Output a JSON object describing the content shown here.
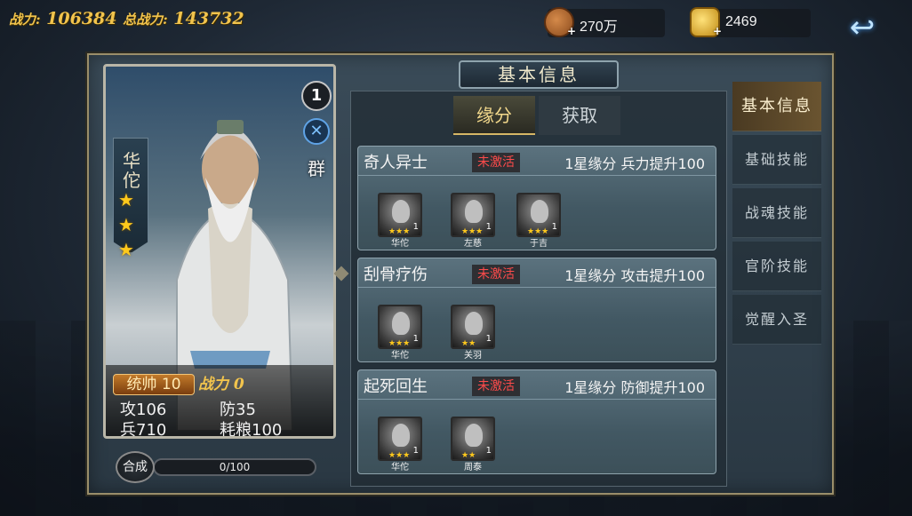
{
  "top_bar": {
    "power_label": "战力:",
    "power_value": "106384",
    "total_power_label": "总战力:",
    "total_power_value": "143732",
    "copper": {
      "icon": "copper-coin-icon",
      "value": "270万"
    },
    "gold": {
      "icon": "gold-ingot-icon",
      "value": "2469"
    },
    "back_icon": "back-arrow-icon",
    "back_glyph": "↩",
    "plus_glyph": "+"
  },
  "hero": {
    "name": "华佗",
    "stars": 3,
    "star_glyph": "★",
    "level": "1",
    "class_icon": "archer-class-icon",
    "class_glyph": "✕",
    "faction": "群",
    "command_label": "统帅",
    "command_value": "10",
    "command_power_label": "战力",
    "command_power_value": "0",
    "stats": {
      "attack_label": "攻",
      "attack_value": "106",
      "defense_label": "防",
      "defense_value": "35",
      "troops_label": "兵",
      "troops_value": "710",
      "food_label": "耗粮",
      "food_value": "100"
    }
  },
  "merge": {
    "button_label": "合成",
    "progress_text": "0/100",
    "progress": 0
  },
  "panel_title": "基本信息",
  "sub_tabs": [
    {
      "label": "缘分",
      "active": true
    },
    {
      "label": "获取",
      "active": false
    }
  ],
  "fates": [
    {
      "title": "奇人异士",
      "status": "未激活",
      "effect": "1星缘分 兵力提升100",
      "members": [
        {
          "name": "华佗",
          "stars": "★★★",
          "count": "1"
        },
        {
          "name": "左慈",
          "stars": "★★★",
          "count": "1"
        },
        {
          "name": "于吉",
          "stars": "★★★",
          "count": "1"
        }
      ]
    },
    {
      "title": "刮骨疗伤",
      "status": "未激活",
      "effect": "1星缘分 攻击提升100",
      "members": [
        {
          "name": "华佗",
          "stars": "★★★",
          "count": "1"
        },
        {
          "name": "关羽",
          "stars": "★★",
          "count": "1"
        }
      ]
    },
    {
      "title": "起死回生",
      "status": "未激活",
      "effect": "1星缘分 防御提升100",
      "members": [
        {
          "name": "华佗",
          "stars": "★★★",
          "count": "1"
        },
        {
          "name": "周泰",
          "stars": "★★",
          "count": "1"
        }
      ]
    }
  ],
  "side_tabs": [
    {
      "label": "基本信息",
      "active": true
    },
    {
      "label": "基础技能",
      "active": false
    },
    {
      "label": "战魂技能",
      "active": false
    },
    {
      "label": "官阶技能",
      "active": false
    },
    {
      "label": "觉醒入圣",
      "active": false
    }
  ],
  "colors": {
    "gold_text": "#f2c44d",
    "inactive_red": "#ff4b4b",
    "accent_blue": "#3aa0e0"
  }
}
